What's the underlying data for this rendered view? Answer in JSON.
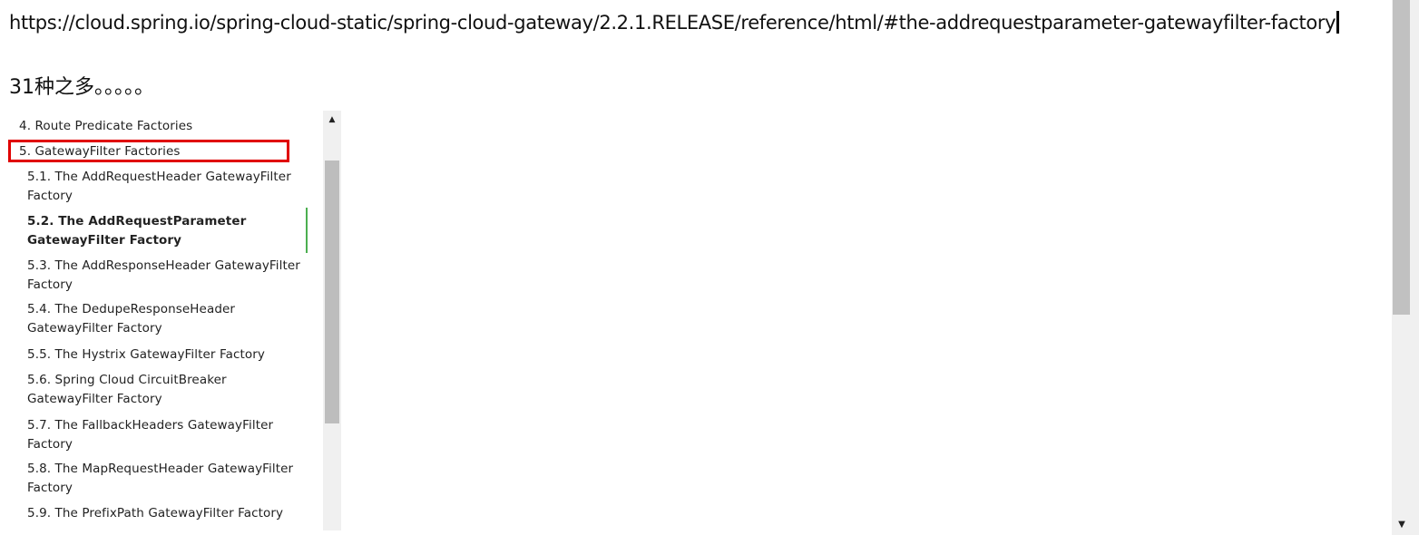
{
  "note": {
    "url": "https://cloud.spring.io/spring-cloud-static/spring-cloud-gateway/2.2.1.RELEASE/reference/html/#the-addrequestparameter-gatewayfilter-factory",
    "count_text": "31种之多。。。。。"
  },
  "toc": {
    "items": [
      {
        "label": "4. Route Predicate Factories"
      },
      {
        "label": "5. GatewayFilter Factories"
      },
      {
        "label": "5.1. The AddRequestHeader GatewayFilter Factory"
      },
      {
        "label": "5.2. The AddRequestParameter GatewayFilter Factory"
      },
      {
        "label": "5.3. The AddResponseHeader GatewayFilter Factory"
      },
      {
        "label": "5.4. The DedupeResponseHeader GatewayFilter Factory"
      },
      {
        "label": "5.5. The Hystrix GatewayFilter Factory"
      },
      {
        "label": "5.6. Spring Cloud CircuitBreaker GatewayFilter Factory"
      },
      {
        "label": "5.7. The FallbackHeaders GatewayFilter Factory"
      },
      {
        "label": "5.8. The MapRequestHeader GatewayFilter Factory"
      },
      {
        "label": "5.9. The PrefixPath GatewayFilter Factory"
      }
    ],
    "active_index": 3,
    "highlight_index": 1,
    "highlight_color": "#e00000",
    "active_color": "#4caf50"
  },
  "icons": {
    "toc_scroll_up": "▲",
    "page_scroll_down": "▼"
  }
}
